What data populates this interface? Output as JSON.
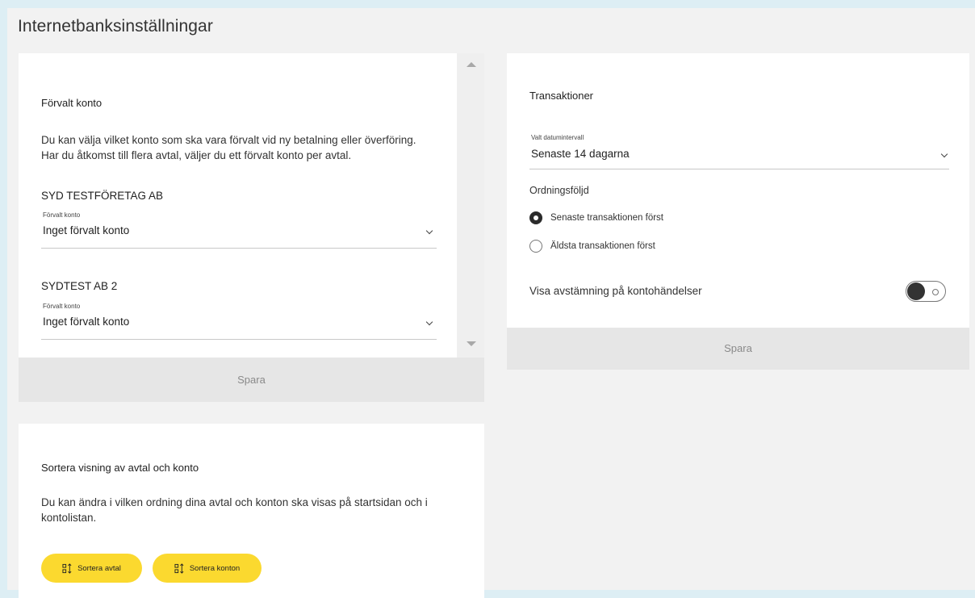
{
  "page": {
    "title": "Internetbanksinställningar"
  },
  "default_account": {
    "title": "Förvalt konto",
    "description_line1": "Du kan välja vilket konto som ska vara förvalt vid ny betalning eller överföring.",
    "description_line2": "Har du åtkomst till flera avtal, väljer du ett förvalt konto per avtal.",
    "agreements": [
      {
        "company": "SYD TESTFÖRETAG AB",
        "field_label": "Förvalt konto",
        "value": "Inget förvalt konto"
      },
      {
        "company": "SYDTEST AB 2",
        "field_label": "Förvalt konto",
        "value": "Inget förvalt konto"
      }
    ],
    "save_label": "Spara"
  },
  "transactions": {
    "title": "Transaktioner",
    "date_range_label": "Valt datumintervall",
    "date_range_value": "Senaste 14 dagarna",
    "order_title": "Ordningsföljd",
    "order_options": [
      {
        "label": "Senaste transaktionen först",
        "selected": true
      },
      {
        "label": "Äldsta transaktionen först",
        "selected": false
      }
    ],
    "reconciliation_label": "Visa avstämning på kontohändelser",
    "reconciliation_enabled": false,
    "save_label": "Spara"
  },
  "sort_display": {
    "title": "Sortera visning av avtal och konto",
    "description_line1": "Du kan ändra i vilken ordning dina avtal och konton ska visas på startsidan och i",
    "description_line2": "kontolistan.",
    "buttons": {
      "sort_agreements": "Sortera avtal",
      "sort_accounts": "Sortera konton"
    }
  },
  "colors": {
    "accent_yellow": "#fbd92f",
    "page_background": "#f2f2f2",
    "outer_background": "#ddeef4"
  },
  "icons": {
    "sort": "sort-icon",
    "dropdown": "chevron-down-icon",
    "scroll_up": "scroll-up-arrow-icon",
    "scroll_down": "scroll-down-arrow-icon"
  }
}
